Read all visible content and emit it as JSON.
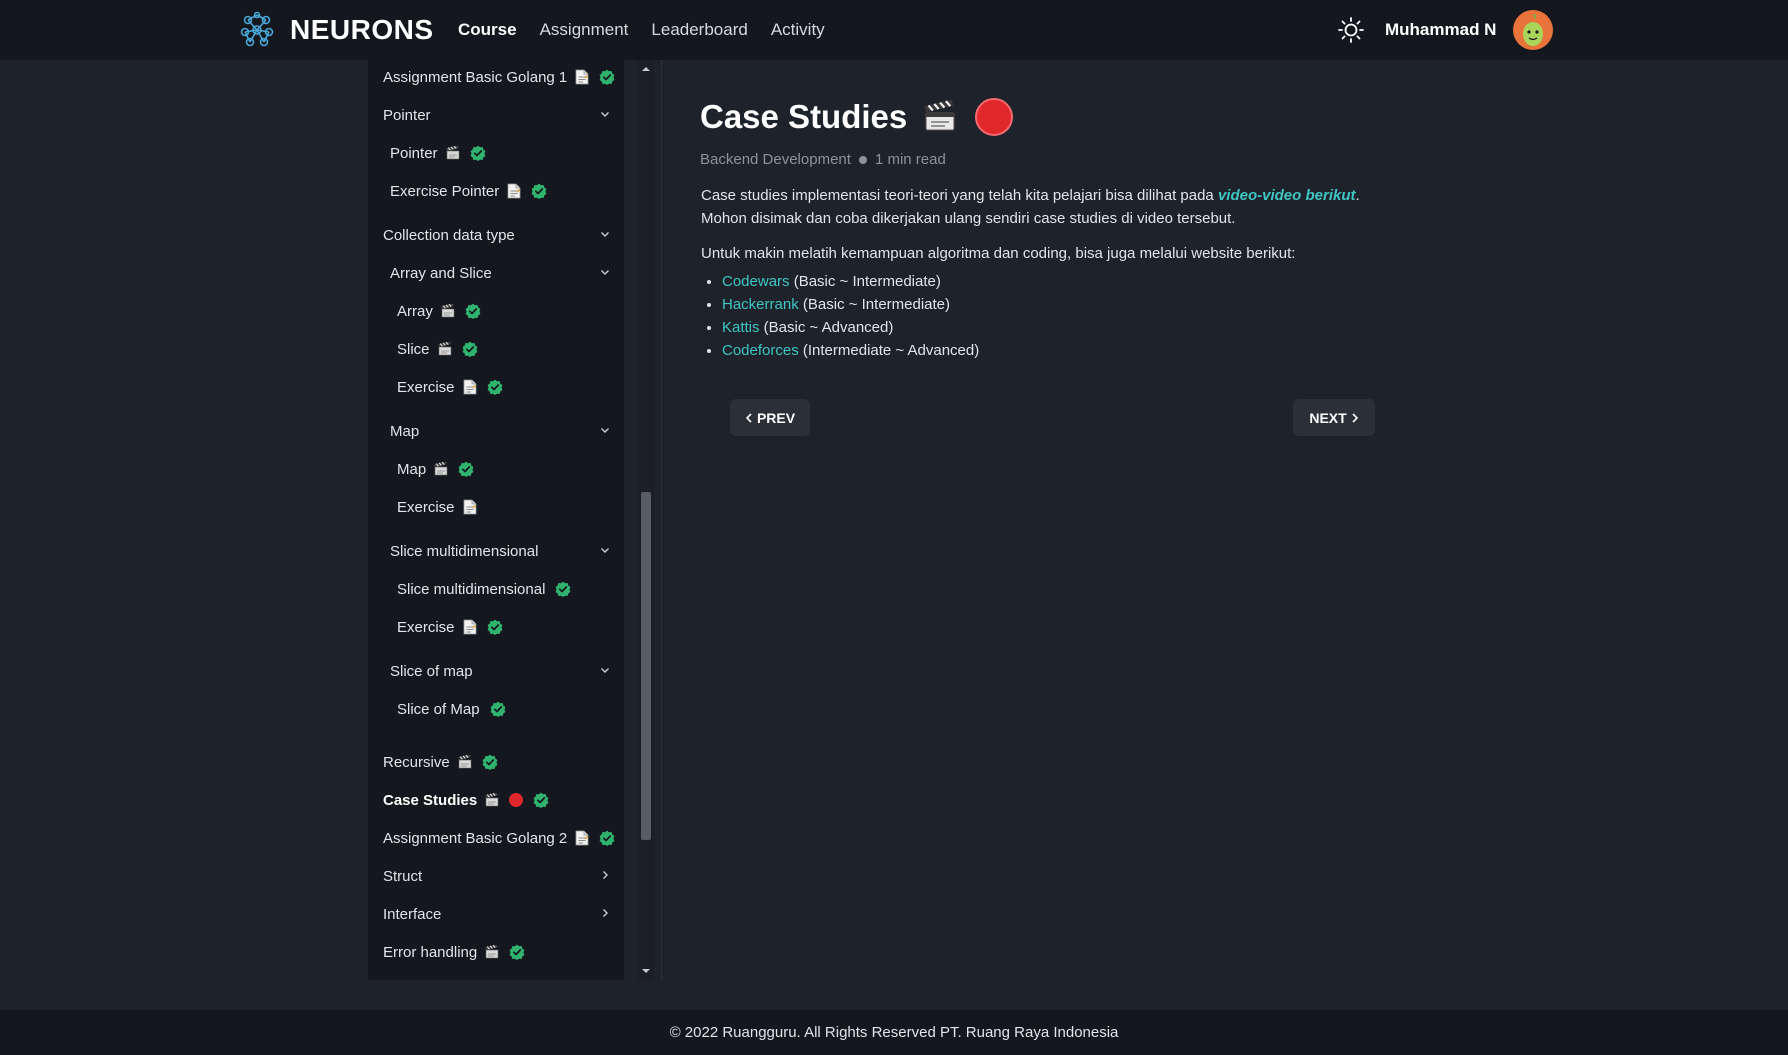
{
  "header": {
    "brand": "NEURONS",
    "nav": [
      {
        "label": "Course",
        "active": true
      },
      {
        "label": "Assignment",
        "active": false
      },
      {
        "label": "Leaderboard",
        "active": false
      },
      {
        "label": "Activity",
        "active": false
      }
    ],
    "username": "Muhammad N"
  },
  "sidebar": {
    "items": [
      {
        "label": "Assignment Basic Golang 1",
        "level": 0,
        "icon": "document-icon",
        "done": true
      },
      {
        "label": "Pointer",
        "level": 0,
        "chevron": "down"
      },
      {
        "label": "Pointer",
        "level": 1,
        "icon": "clapperboard-icon",
        "done": true
      },
      {
        "label": "Exercise Pointer",
        "level": 1,
        "icon": "document-icon",
        "done": true
      },
      {
        "label": "Collection data type",
        "level": 0,
        "chevron": "down"
      },
      {
        "label": "Array and Slice",
        "level": 1,
        "chevron": "down"
      },
      {
        "label": "Array",
        "level": 2,
        "icon": "clapperboard-icon",
        "done": true
      },
      {
        "label": "Slice",
        "level": 2,
        "icon": "clapperboard-icon",
        "done": true
      },
      {
        "label": "Exercise",
        "level": 2,
        "icon": "document-icon",
        "done": true
      },
      {
        "label": "Map",
        "level": 1,
        "chevron": "down"
      },
      {
        "label": "Map",
        "level": 2,
        "icon": "clapperboard-icon",
        "done": true
      },
      {
        "label": "Exercise",
        "level": 2,
        "icon": "document-icon",
        "done": false
      },
      {
        "label": "Slice multidimensional",
        "level": 1,
        "chevron": "down"
      },
      {
        "label": "Slice multidimensional",
        "level": 2,
        "done": true
      },
      {
        "label": "Exercise",
        "level": 2,
        "icon": "document-icon",
        "done": true
      },
      {
        "label": "Slice of map",
        "level": 1,
        "chevron": "down"
      },
      {
        "label": "Slice of Map",
        "level": 2,
        "done": true
      },
      {
        "label": "Recursive",
        "level": 0,
        "icon": "clapperboard-icon",
        "done": true
      },
      {
        "label": "Case Studies",
        "level": 0,
        "icon": "clapperboard-icon",
        "live": true,
        "done": true,
        "active": true
      },
      {
        "label": "Assignment Basic Golang 2",
        "level": 0,
        "icon": "document-icon",
        "done": true
      },
      {
        "label": "Struct",
        "level": 0,
        "chevron": "right"
      },
      {
        "label": "Interface",
        "level": 0,
        "chevron": "right"
      },
      {
        "label": "Error handling",
        "level": 0,
        "icon": "clapperboard-icon",
        "done": true
      }
    ]
  },
  "content": {
    "title": "Case Studies",
    "category": "Backend Development",
    "read_time": "1 min read",
    "para1_text": "Case studies implementasi teori-teori yang telah kita pelajari bisa dilihat pada ",
    "para1_link": "video-video berikut",
    "para1_end": ".",
    "para1_line2": "Mohon disimak dan coba dikerjakan ulang sendiri case studies di video tersebut.",
    "para2": "Untuk makin melatih kemampuan algoritma dan coding, bisa juga melalui website berikut:",
    "links": [
      {
        "name": "Codewars",
        "level": " (Basic ~ Intermediate)"
      },
      {
        "name": "Hackerrank",
        "level": " (Basic ~ Intermediate)"
      },
      {
        "name": "Kattis",
        "level": " (Basic ~ Advanced)"
      },
      {
        "name": "Codeforces",
        "level": " (Intermediate ~ Advanced)"
      }
    ],
    "prev_label": "PREV",
    "next_label": "NEXT"
  },
  "footer": {
    "text": "© 2022 Ruangguru. All Rights Reserved PT. Ruang Raya Indonesia"
  },
  "colors": {
    "accent": "#3fc6c2",
    "done_check": "#2fb36f",
    "live_red": "#e0272c",
    "background": "#1e222b",
    "panel": "#14171d"
  }
}
